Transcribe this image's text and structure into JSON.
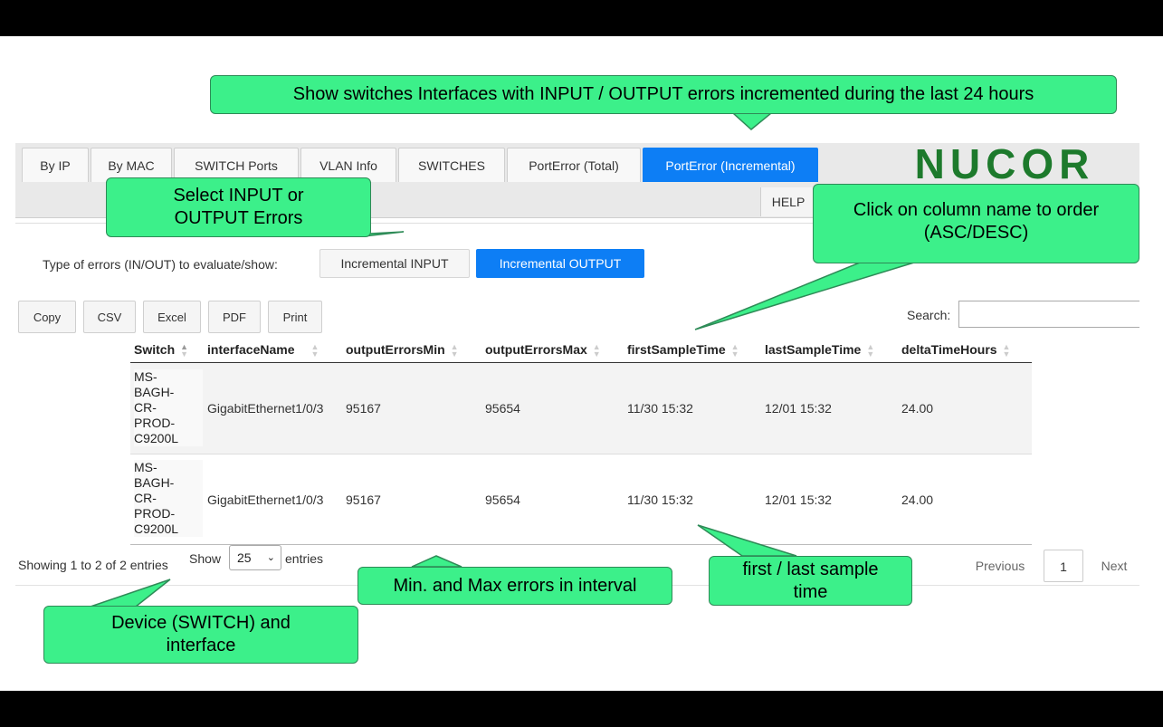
{
  "tabs": [
    {
      "label": "By IP"
    },
    {
      "label": "By MAC"
    },
    {
      "label": "SWITCH Ports"
    },
    {
      "label": "VLAN Info"
    },
    {
      "label": "SWITCHES"
    },
    {
      "label": "PortError (Total)"
    },
    {
      "label": "PortError (Incremental)",
      "active": true
    }
  ],
  "help_label": "HELP",
  "logo_text": "NUCOR",
  "brand_color": "#1d7a2c",
  "error_type": {
    "label": "Type of errors (IN/OUT) to evaluate/show:",
    "input_label": "Incremental INPUT",
    "output_label": "Incremental OUTPUT",
    "selected": "Incremental OUTPUT"
  },
  "export_buttons": [
    "Copy",
    "CSV",
    "Excel",
    "PDF",
    "Print"
  ],
  "search": {
    "label": "Search:",
    "value": ""
  },
  "table": {
    "columns": [
      "Switch",
      "interfaceName",
      "outputErrorsMin",
      "outputErrorsMax",
      "firstSampleTime",
      "lastSampleTime",
      "deltaTimeHours"
    ],
    "rows": [
      {
        "switch": [
          "MS-",
          "BAGH-",
          "CR-",
          "PROD-",
          "C9200L"
        ],
        "interfaceName": "GigabitEthernet1/0/3",
        "outputErrorsMin": "95167",
        "outputErrorsMax": "95654",
        "firstSampleTime": "11/30 15:32",
        "lastSampleTime": "12/01 15:32",
        "deltaTimeHours": "24.00"
      },
      {
        "switch": [
          "MS-",
          "BAGH-",
          "CR-",
          "PROD-",
          "C9200L"
        ],
        "interfaceName": "GigabitEthernet1/0/3",
        "outputErrorsMin": "95167",
        "outputErrorsMax": "95654",
        "firstSampleTime": "11/30 15:32",
        "lastSampleTime": "12/01 15:32",
        "deltaTimeHours": "24.00"
      }
    ]
  },
  "info_text": "Showing 1 to 2 of 2 entries",
  "length_menu": {
    "show": "Show",
    "value": "25",
    "entries": "entries"
  },
  "pagination": {
    "previous": "Previous",
    "page": "1",
    "next": "Next"
  },
  "callouts": {
    "top": "Show switches Interfaces with INPUT / OUTPUT errors incremented during the last 24 hours",
    "select_line1": "Select INPUT or",
    "select_line2": "OUTPUT Errors",
    "order_line1": "Click on column name to order",
    "order_line2": "(ASC/DESC)",
    "minmax": "Min. and Max errors in interval",
    "sample_line1": "first / last sample",
    "sample_line2": "time",
    "device_line1": "Device (SWITCH) and",
    "device_line2": "interface"
  },
  "callout_color": "#3cf08a"
}
